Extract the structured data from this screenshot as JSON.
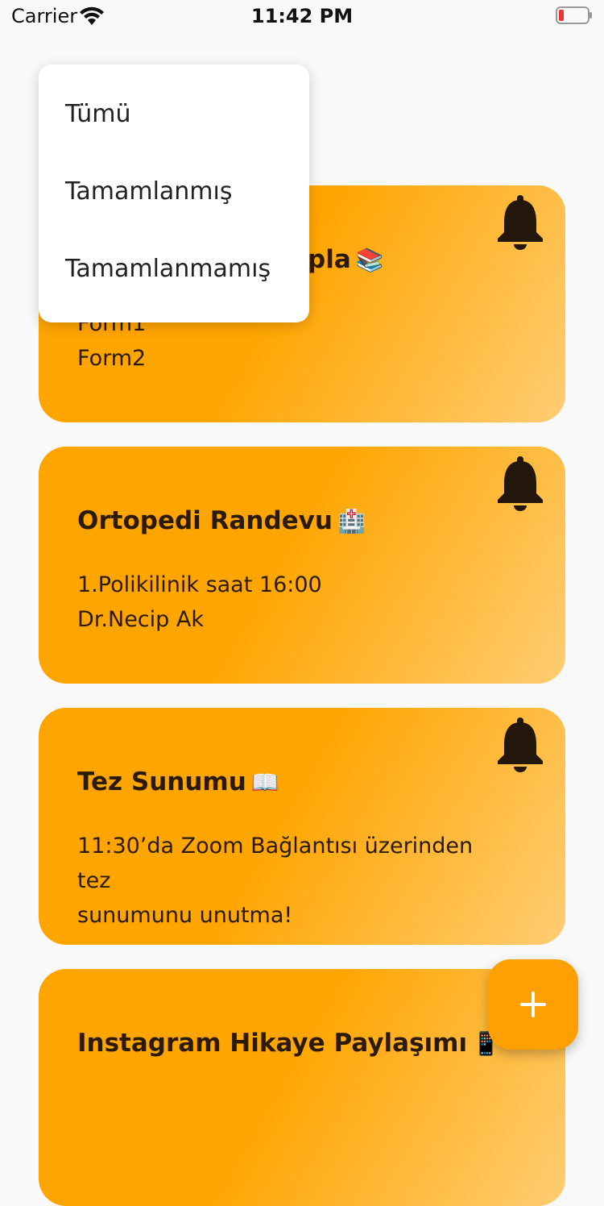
{
  "status_bar": {
    "carrier": "Carrier",
    "time": "11:42 PM"
  },
  "header": {
    "theme_toggle_icon": "moon-icon"
  },
  "filter_menu": {
    "items": [
      "Tümü",
      "Tamamlanmış",
      "Tamamlanmamış"
    ]
  },
  "tasks": [
    {
      "title": "pla",
      "emoji": "📚",
      "lines": [
        "Form1",
        "Form2"
      ],
      "icon": "bell-icon"
    },
    {
      "title": "Ortopedi Randevu",
      "emoji": "🏥",
      "lines": [
        "1.Polikilinik saat 16:00",
        "Dr.Necip Ak"
      ],
      "icon": "bell-icon"
    },
    {
      "title": "Tez Sunumu",
      "emoji": "📖",
      "lines": [
        "11:30’da Zoom Bağlantısı üzerinden tez",
        "sunumunu unutma!"
      ],
      "icon": "bell-icon"
    },
    {
      "title": "Instagram Hikaye Paylaşımı",
      "emoji": "📱",
      "lines": [],
      "icon": ""
    }
  ],
  "fab": {
    "icon": "plus-icon"
  },
  "colors": {
    "accent": "#ffa500",
    "accent_light": "#ffcd73",
    "fab": "#ff9f00",
    "text": "#2a1a06"
  }
}
